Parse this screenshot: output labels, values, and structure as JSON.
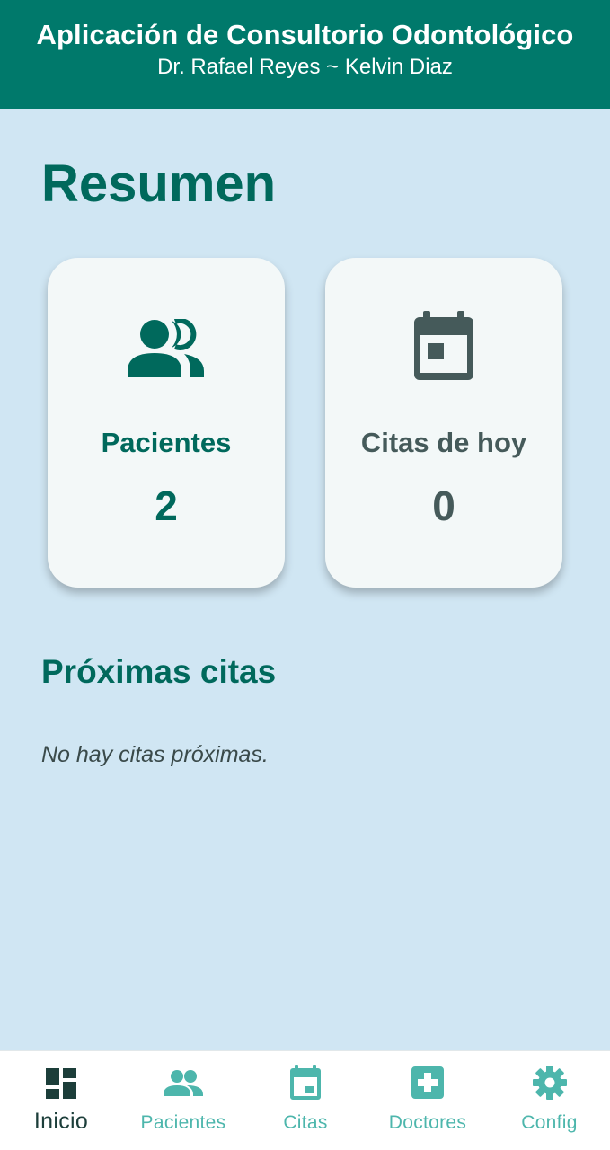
{
  "header": {
    "title": "Aplicación de Consultorio Odontológico",
    "subtitle": "Dr. Rafael Reyes ~ Kelvin Diaz",
    "background_color": "#00796b"
  },
  "main": {
    "title": "Resumen",
    "cards": [
      {
        "icon": "people-icon",
        "label": "Pacientes",
        "value": "2",
        "color": "#00695c"
      },
      {
        "icon": "calendar-icon",
        "label": "Citas de hoy",
        "value": "0",
        "color": "#455a5a"
      }
    ],
    "upcoming": {
      "title": "Próximas citas",
      "empty_message": "No hay citas próximas."
    }
  },
  "bottom_nav": {
    "active": "Inicio",
    "items": [
      {
        "icon": "dashboard-icon",
        "label": "Inicio"
      },
      {
        "icon": "people-icon",
        "label": "Pacientes"
      },
      {
        "icon": "calendar-icon",
        "label": "Citas"
      },
      {
        "icon": "medical-plus-icon",
        "label": "Doctores"
      },
      {
        "icon": "gear-icon",
        "label": "Config"
      }
    ]
  },
  "colors": {
    "primary": "#00796b",
    "background": "#d0e6f3",
    "card": "#f3f8f8",
    "nav_inactive": "#4db6ac",
    "nav_active": "#1c3e3a"
  }
}
